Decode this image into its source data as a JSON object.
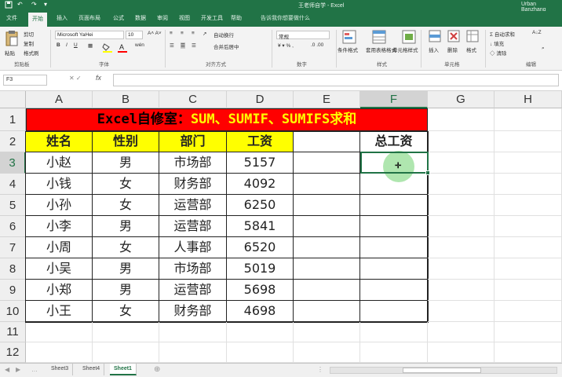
{
  "app": {
    "title": "王老师自学 - Excel",
    "user": "Urban Banzhang",
    "quick_access": [
      "save",
      "undo",
      "redo"
    ]
  },
  "ribbon_tabs": [
    "文件",
    "开始",
    "插入",
    "页面布局",
    "公式",
    "数据",
    "审阅",
    "视图",
    "开发工具",
    "帮助"
  ],
  "active_tab": "开始",
  "tell_me": "告诉我你想要做什么",
  "ribbon": {
    "clipboard": {
      "label": "剪贴板",
      "paste": "粘贴",
      "cut": "剪切",
      "copy": "复制",
      "format_painter": "格式刷"
    },
    "font": {
      "label": "字体",
      "font_name": "Microsoft YaHei",
      "font_size": "10"
    },
    "alignment": {
      "label": "对齐方式",
      "wrap": "自动换行",
      "merge": "合并后居中"
    },
    "number": {
      "label": "数字",
      "format": "常规"
    },
    "styles": {
      "label": "样式",
      "conditional": "条件格式",
      "table": "套用表格格式",
      "cell_styles": "单元格样式"
    },
    "cells": {
      "label": "单元格",
      "insert": "插入",
      "delete": "删除",
      "format": "格式"
    },
    "editing": {
      "label": "编辑",
      "autosum": "自动求和",
      "fill": "填充",
      "clear": "清除",
      "sort": "排序和筛选",
      "find": "查找和选择"
    }
  },
  "formula_bar": {
    "name_box": "F3",
    "fx": "fx",
    "value": ""
  },
  "columns": [
    "A",
    "B",
    "C",
    "D",
    "E",
    "F",
    "G",
    "H"
  ],
  "selected_column": "F",
  "rows": [
    "1",
    "2",
    "3",
    "4",
    "5",
    "6",
    "7",
    "8",
    "9",
    "10",
    "11",
    "12"
  ],
  "selected_row": "3",
  "title_row": {
    "part1": "Excel自修室：",
    "part2": "SUM、SUMIF、SUMIFS求和"
  },
  "headers": {
    "name": "姓名",
    "gender": "性别",
    "dept": "部门",
    "salary": "工资",
    "total": "总工资"
  },
  "table": [
    [
      "小赵",
      "男",
      "市场部",
      "5157"
    ],
    [
      "小钱",
      "女",
      "财务部",
      "4092"
    ],
    [
      "小孙",
      "女",
      "运营部",
      "6250"
    ],
    [
      "小李",
      "男",
      "运营部",
      "5841"
    ],
    [
      "小周",
      "女",
      "人事部",
      "6520"
    ],
    [
      "小吴",
      "男",
      "市场部",
      "5019"
    ],
    [
      "小郑",
      "男",
      "运营部",
      "5698"
    ],
    [
      "小王",
      "女",
      "财务部",
      "4698"
    ]
  ],
  "sheets": [
    "Sheet3",
    "Sheet4",
    "Sheet1"
  ],
  "active_sheet": "Sheet1",
  "colors": {
    "accent": "#217346",
    "title_bg": "#ff0000",
    "title_highlight": "#ffff00",
    "header_bg": "#ffff00"
  }
}
